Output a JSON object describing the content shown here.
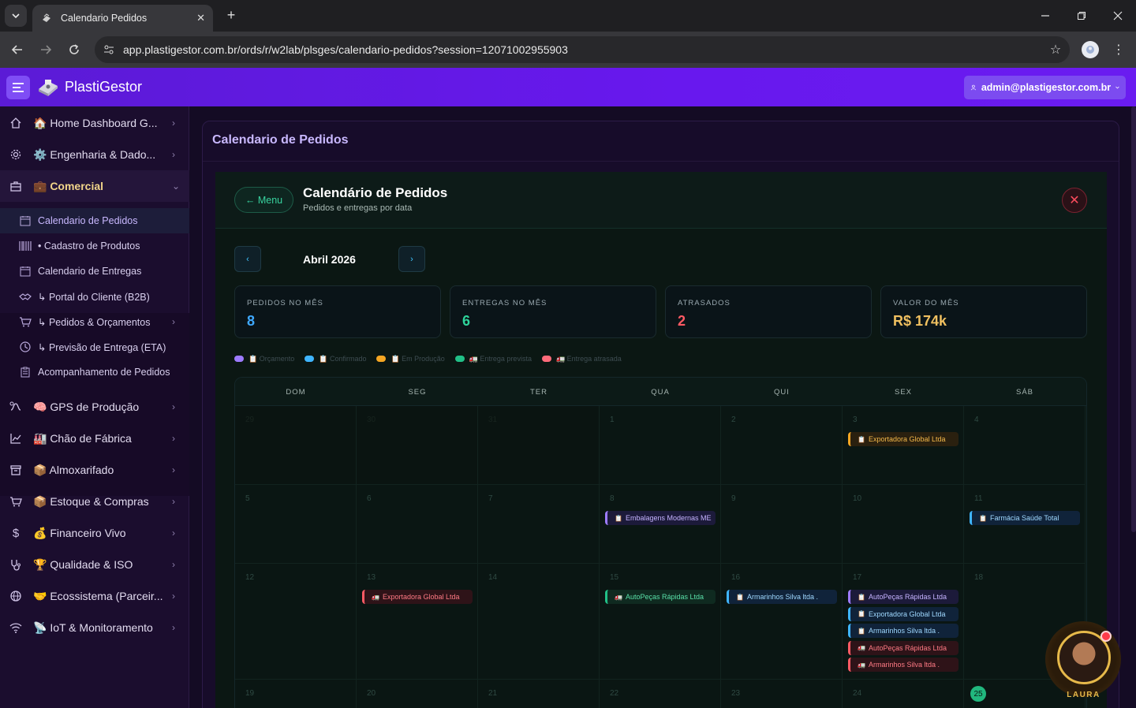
{
  "browser": {
    "tab_title": "Calendario Pedidos",
    "url": "app.plastigestor.com.br/ords/r/w2lab/plsges/calendario-pedidos?session=12071002955903"
  },
  "app": {
    "brand": "PlastiGestor",
    "user_email": "admin@plastigestor.com.br"
  },
  "sidebar": {
    "items": [
      {
        "label": "🏠 Home Dashboard G...",
        "icon": "home-icon"
      },
      {
        "label": "⚙️ Engenharia & Dado...",
        "icon": "gear-icon"
      },
      {
        "label": "💼 Comercial",
        "icon": "briefcase-icon"
      },
      {
        "label": "🧠 GPS de Produção",
        "icon": "route-icon"
      },
      {
        "label": "🏭 Chão de Fábrica",
        "icon": "chart-icon"
      },
      {
        "label": "📦 Almoxarifado",
        "icon": "archive-icon"
      },
      {
        "label": "📦 Estoque & Compras",
        "icon": "cart-icon"
      },
      {
        "label": "💰 Financeiro Vivo",
        "icon": "dollar-icon"
      },
      {
        "label": "🏆 Qualidade & ISO",
        "icon": "stethoscope-icon"
      },
      {
        "label": "🤝 Ecossistema (Parceir...",
        "icon": "globe-icon"
      },
      {
        "label": "📡 IoT & Monitoramento",
        "icon": "wifi-icon"
      }
    ],
    "sub_items": [
      {
        "label": "Calendario de Pedidos",
        "icon": "calendar-icon"
      },
      {
        "label": "• Cadastro de Produtos",
        "icon": "barcode-icon"
      },
      {
        "label": "Calendario de Entregas",
        "icon": "calendar-icon"
      },
      {
        "label": "↳ Portal do Cliente (B2B)",
        "icon": "handshake-icon"
      },
      {
        "label": "↳ Pedidos & Orçamentos",
        "icon": "cart-icon"
      },
      {
        "label": "↳ Previsão de Entrega (ETA)",
        "icon": "clock-icon"
      },
      {
        "label": "Acompanhamento de Pedidos",
        "icon": "clipboard-icon"
      }
    ]
  },
  "page": {
    "region_title": "Calendario de Pedidos",
    "menu_button": "← Menu",
    "title": "Calendário de Pedidos",
    "subtitle": "Pedidos e entregas por data",
    "close_label": "✕",
    "month": "Abril 2026",
    "prev_label": "‹",
    "next_label": "›"
  },
  "kpis": [
    {
      "label": "PEDIDOS NO MÊS",
      "value": "8",
      "color": "#3fa9ff"
    },
    {
      "label": "ENTREGAS NO MÊS",
      "value": "6",
      "color": "#2ed39a"
    },
    {
      "label": "ATRASADOS",
      "value": "2",
      "color": "#ff5a64"
    },
    {
      "label": "VALOR DO MÊS",
      "value": "R$ 174k",
      "color": "#f0c060"
    }
  ],
  "legend": [
    {
      "label": "📋 Orçamento",
      "color": "#9d7bff"
    },
    {
      "label": "📋 Confirmado",
      "color": "#3fb5ff"
    },
    {
      "label": "📋 Em Produção",
      "color": "#f5a623"
    },
    {
      "label": "🚛 Entrega prevista",
      "color": "#21c087"
    },
    {
      "label": "🚛 Entrega atrasada",
      "color": "#ff6b7a"
    }
  ],
  "calendar": {
    "weekdays": [
      "DOM",
      "SEG",
      "TER",
      "QUA",
      "QUI",
      "SEX",
      "SÁB"
    ],
    "weeks": [
      [
        "29",
        "30",
        "31",
        "1",
        "2",
        "3",
        "4"
      ],
      [
        "5",
        "6",
        "7",
        "8",
        "9",
        "10",
        "11"
      ],
      [
        "12",
        "13",
        "14",
        "15",
        "16",
        "17",
        "18"
      ],
      [
        "19",
        "20",
        "21",
        "22",
        "23",
        "24",
        "25"
      ]
    ],
    "today": "25",
    "events": {
      "3": [
        {
          "text": "Exportadora Global Ltda",
          "kind": "producao"
        }
      ],
      "8": [
        {
          "text": "Embalagens Modernas ME",
          "kind": "orcamento"
        }
      ],
      "11": [
        {
          "text": "Farmácia Saúde Total",
          "kind": "confirmado"
        }
      ],
      "13": [
        {
          "text": "Exportadora Global Ltda",
          "kind": "atrasada"
        }
      ],
      "15": [
        {
          "text": "AutoPeças Rápidas Ltda",
          "kind": "prevista"
        }
      ],
      "16": [
        {
          "text": "Armarinhos Silva ltda .",
          "kind": "confirmado"
        }
      ],
      "17": [
        {
          "text": "AutoPeças Rápidas Ltda",
          "kind": "orcamento"
        },
        {
          "text": "Exportadora Global Ltda",
          "kind": "confirmado"
        },
        {
          "text": "Armarinhos Silva ltda .",
          "kind": "confirmado"
        },
        {
          "text": "AutoPeças Rápidas Ltda",
          "kind": "atrasada"
        },
        {
          "text": "Armarinhos Silva ltda .",
          "kind": "atrasada"
        }
      ]
    }
  },
  "assistant": {
    "name": "LAURA"
  }
}
